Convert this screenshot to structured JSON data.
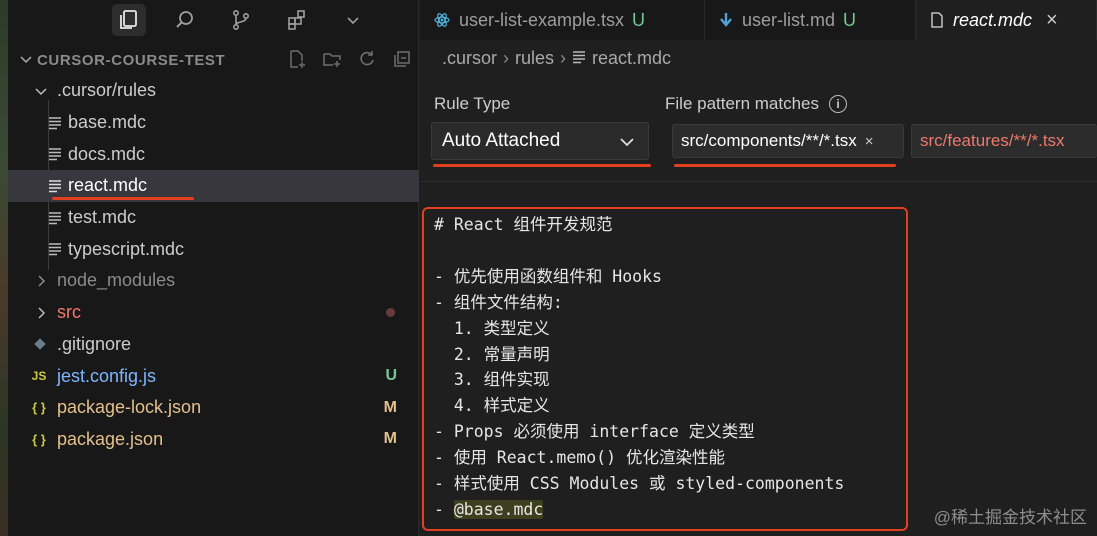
{
  "tabs": [
    {
      "label": "user-list-example.tsx",
      "status": "U",
      "icon": "react-icon",
      "active": false
    },
    {
      "label": "user-list.md",
      "status": "U",
      "icon": "markdown-icon",
      "active": false
    },
    {
      "label": "react.mdc",
      "status": "",
      "icon": "file-icon",
      "active": true,
      "close": "×"
    }
  ],
  "explorer": {
    "title": "CURSOR-COURSE-TEST",
    "items": [
      {
        "label": ".cursor/rules",
        "kind": "folder-open"
      },
      {
        "label": "base.mdc",
        "kind": "mdc"
      },
      {
        "label": "docs.mdc",
        "kind": "mdc"
      },
      {
        "label": "react.mdc",
        "kind": "mdc",
        "selected": true
      },
      {
        "label": "test.mdc",
        "kind": "mdc"
      },
      {
        "label": "typescript.mdc",
        "kind": "mdc"
      },
      {
        "label": "node_modules",
        "kind": "folder"
      },
      {
        "label": "src",
        "kind": "folder"
      },
      {
        "label": ".gitignore",
        "kind": "git"
      },
      {
        "label": "jest.config.js",
        "kind": "js",
        "badge": "U"
      },
      {
        "label": "package-lock.json",
        "kind": "json",
        "badge": "M"
      },
      {
        "label": "package.json",
        "kind": "json",
        "badge": "M"
      }
    ]
  },
  "breadcrumb": [
    ".cursor",
    "rules",
    "react.mdc"
  ],
  "rule": {
    "type_label": "Rule Type",
    "type_value": "Auto Attached",
    "patterns_label": "File pattern matches",
    "patterns": [
      "src/components/**/*.tsx",
      "src/features/**/*.tsx"
    ]
  },
  "content_lines": [
    "# React 组件开发规范",
    "",
    "- 优先使用函数组件和 Hooks",
    "- 组件文件结构:",
    "  1. 类型定义",
    "  2. 常量声明",
    "  3. 组件实现",
    "  4. 样式定义",
    "- Props 必须使用 interface 定义类型",
    "- 使用 React.memo() 优化渲染性能",
    "- 样式使用 CSS Modules 或 styled-components",
    "- @base.mdc"
  ],
  "watermark": "@稀土掘金技术社区",
  "colors": {
    "accent_red": "#e0401e",
    "untracked_green": "#73c991",
    "modified_yellow": "#e2c08d",
    "json_yellow": "#cbcb41",
    "pattern_red": "#f0786c",
    "js_blue": "#7eb6ff"
  }
}
